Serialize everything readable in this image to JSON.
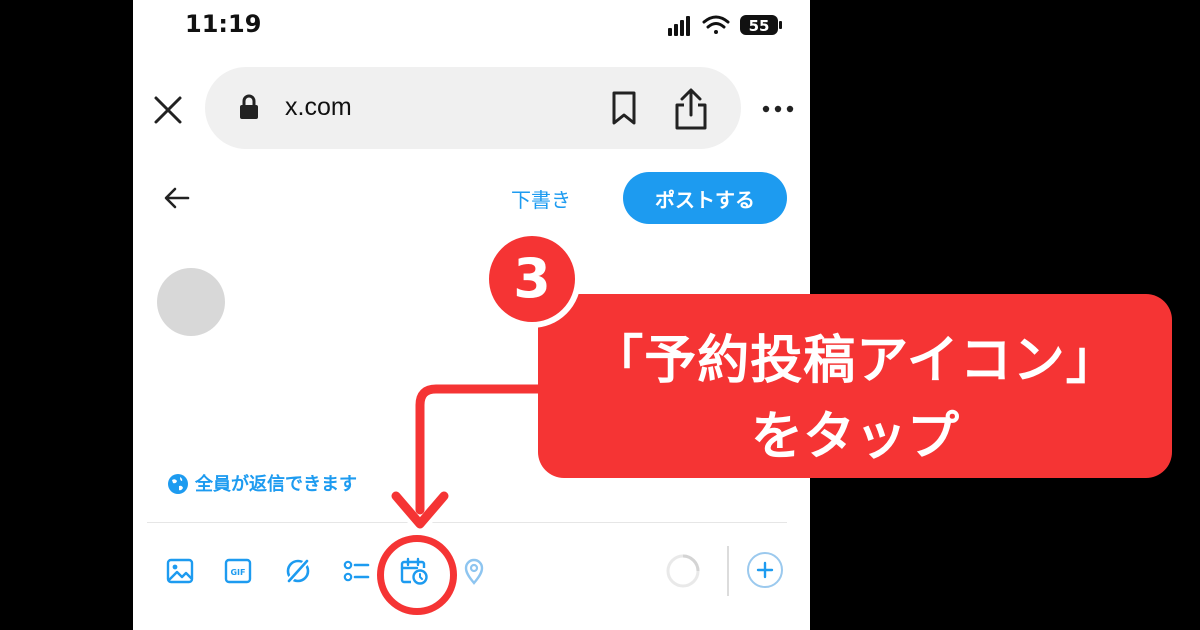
{
  "status_bar": {
    "time": "11:19",
    "battery": "55"
  },
  "browser": {
    "url": "x.com"
  },
  "compose": {
    "draft_label": "下書き",
    "post_label": "ポストする",
    "reply_setting": "全員が返信できます",
    "toolbar": {
      "gif_label": "GIF",
      "items": [
        "image-icon",
        "gif-icon",
        "grok-icon",
        "poll-icon",
        "schedule-icon",
        "location-icon"
      ]
    }
  },
  "annotation": {
    "step_number": "3",
    "line1": "「予約投稿アイコン」",
    "line2": "をタップ"
  },
  "colors": {
    "accent": "#1d9bf0",
    "annotation_red": "#f53434",
    "black_bg": "#000000"
  }
}
